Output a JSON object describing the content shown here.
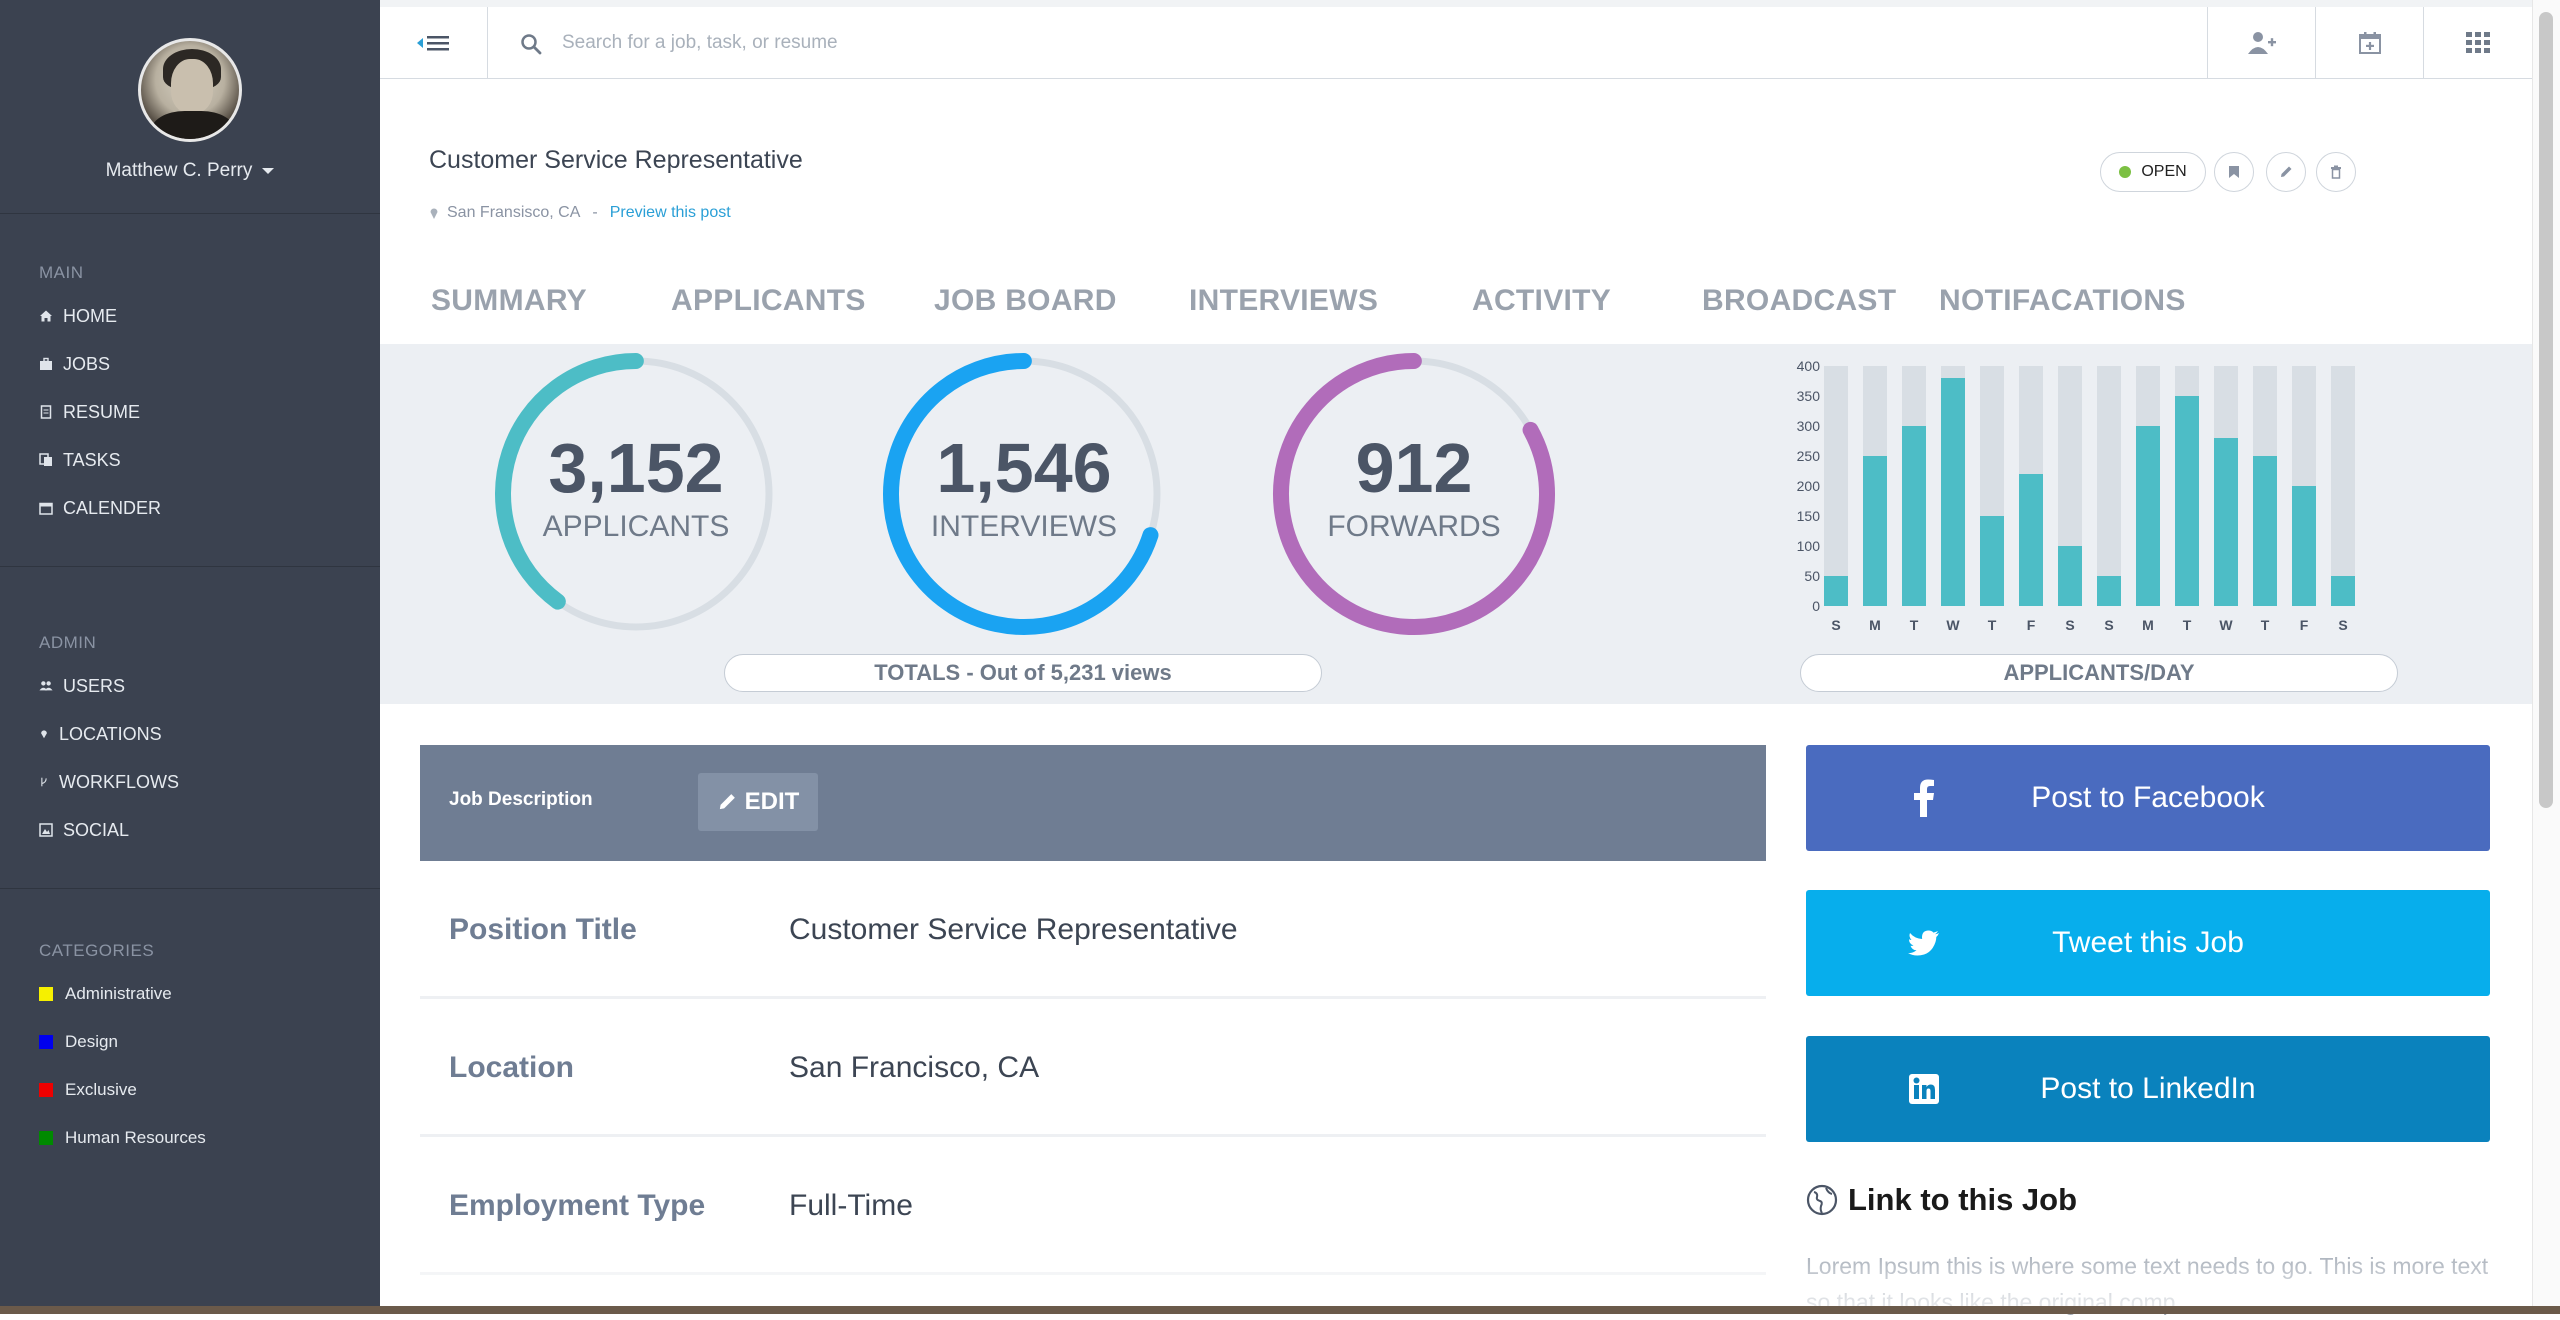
{
  "sidebar": {
    "user_name": "Matthew C. Perry",
    "main_heading": "MAIN",
    "main_items": [
      {
        "label": "HOME",
        "icon": "home-icon"
      },
      {
        "label": "JOBS",
        "icon": "briefcase-icon"
      },
      {
        "label": "RESUME",
        "icon": "document-icon"
      },
      {
        "label": "TASKS",
        "icon": "tasks-icon"
      },
      {
        "label": "CALENDER",
        "icon": "calendar-icon"
      }
    ],
    "admin_heading": "ADMIN",
    "admin_items": [
      {
        "label": "USERS",
        "icon": "users-icon"
      },
      {
        "label": "LOCATIONS",
        "icon": "pin-icon"
      },
      {
        "label": "WORKFLOWS",
        "icon": "workflow-icon"
      },
      {
        "label": "SOCIAL",
        "icon": "social-icon"
      }
    ],
    "categories_heading": "CATEGORIES",
    "categories": [
      {
        "label": "Administrative",
        "color": "#f6f000"
      },
      {
        "label": "Design",
        "color": "#0000ee"
      },
      {
        "label": "Exclusive",
        "color": "#ee0000"
      },
      {
        "label": "Human Resources",
        "color": "#008a00"
      }
    ]
  },
  "topbar": {
    "search_placeholder": "Search for a job, task, or resume",
    "buttons": [
      "add-user-icon",
      "calendar-add-icon",
      "grid-icon"
    ]
  },
  "job": {
    "title": "Customer Service Representative",
    "location": "San Fransisco, CA",
    "separator": "-",
    "preview_link": "Preview this post",
    "status": "OPEN",
    "status_color": "#7cc043"
  },
  "tabs": [
    "SUMMARY",
    "APPLICANTS",
    "JOB BOARD",
    "INTERVIEWS",
    "ACTIVITY",
    "BROADCAST",
    "NOTIFACATIONS"
  ],
  "stats": {
    "rings": [
      {
        "value": "3,152",
        "label": "APPLICANTS",
        "fraction": 0.6,
        "color": "#4dbdc6"
      },
      {
        "value": "1,546",
        "label": "INTERVIEWS",
        "fraction": 0.3,
        "color": "#1aa3f2"
      },
      {
        "value": "912",
        "label": "FORWARDS",
        "fraction": 0.17,
        "color": "#b16cba"
      }
    ],
    "totals_label": "TOTALS - Out of 5,231 views",
    "chart_label": "APPLICANTS/DAY"
  },
  "chart_data": {
    "type": "bar",
    "categories": [
      "S",
      "M",
      "T",
      "W",
      "T",
      "F",
      "S",
      "S",
      "M",
      "T",
      "W",
      "T",
      "F",
      "S"
    ],
    "values": [
      50,
      250,
      300,
      380,
      150,
      220,
      100,
      50,
      300,
      350,
      280,
      250,
      200,
      50
    ],
    "ylim": [
      0,
      400
    ],
    "yticks": [
      "400",
      "350",
      "300",
      "250",
      "200",
      "150",
      "100",
      "50",
      "0"
    ],
    "bar_color": "#4dbdc6",
    "track_color": "#d8dee4"
  },
  "job_description": {
    "header": "Job Description",
    "edit_label": "EDIT",
    "rows": [
      {
        "key": "Position Title",
        "value": "Customer Service Representative"
      },
      {
        "key": "Location",
        "value": "San Francisco, CA"
      },
      {
        "key": "Employment Type",
        "value": "Full-Time"
      }
    ]
  },
  "share": {
    "facebook": {
      "label": "Post to Facebook",
      "color": "#4a6bbf"
    },
    "twitter": {
      "label": "Tweet this Job",
      "color": "#07aeec"
    },
    "linkedin": {
      "label": "Post to LinkedIn",
      "color": "#0a82bd"
    },
    "link_heading": "Link to this Job",
    "link_text": "Lorem Ipsum this is where some text needs to go. This is more text so that it looks like the original comp."
  }
}
